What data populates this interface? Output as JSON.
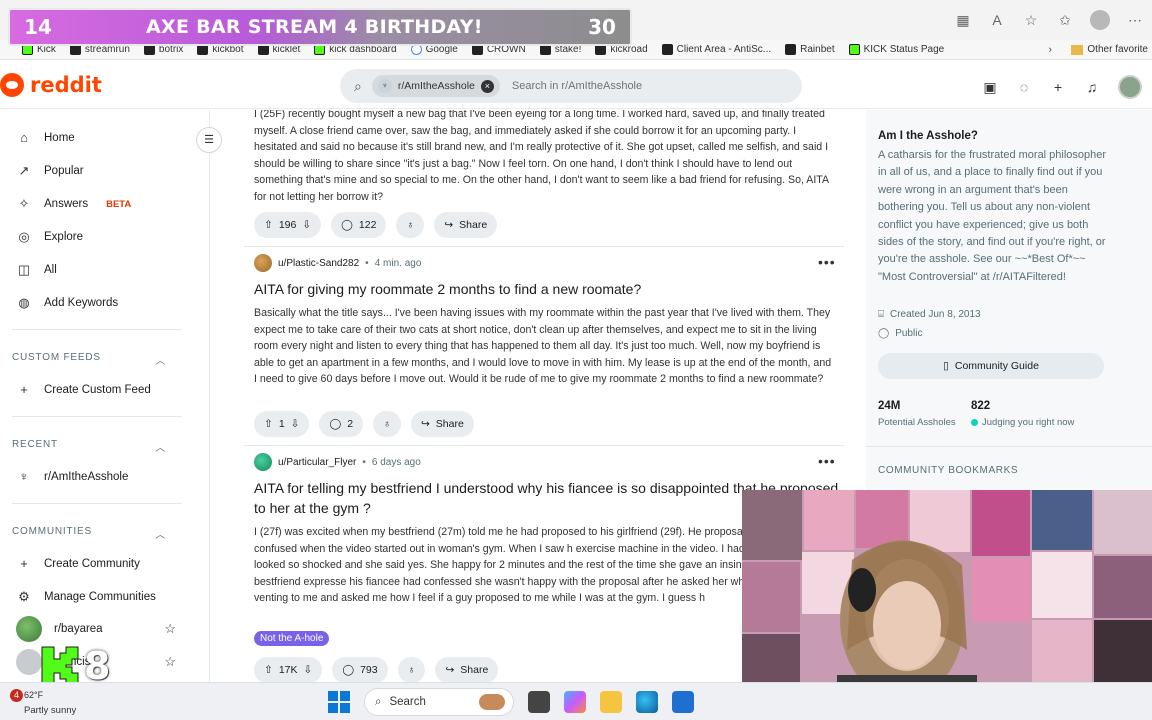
{
  "overlay": {
    "left_num": "14",
    "title": "AXE BAR STREAM 4 BIRTHDAY!",
    "right_num": "30"
  },
  "bookmarks": [
    {
      "label": "Kick",
      "icon": "kick-icon"
    },
    {
      "label": "streamrun",
      "icon": "streamrun-icon"
    },
    {
      "label": "botrix",
      "icon": "botrix-icon"
    },
    {
      "label": "kickbot",
      "icon": "kickbot-icon"
    },
    {
      "label": "kicklet",
      "icon": "kicklet-icon"
    },
    {
      "label": "kick dashboard",
      "icon": "kick-icon"
    },
    {
      "label": "Google",
      "icon": "google-icon"
    },
    {
      "label": "CROWN",
      "icon": "crown-icon"
    },
    {
      "label": "stake!",
      "icon": "stake-icon"
    },
    {
      "label": "kickroad",
      "icon": "kickroad-icon"
    },
    {
      "label": "Client Area - AntiSc...",
      "icon": "page-icon"
    },
    {
      "label": "Rainbet",
      "icon": "rainbet-icon"
    },
    {
      "label": "KICK Status Page",
      "icon": "kick-icon"
    }
  ],
  "bookmarks_other": "Other favorite",
  "header": {
    "logo_text": "reddit",
    "search_chip": "r/AmItheAsshole",
    "search_placeholder": "Search in r/AmItheAsshole"
  },
  "sidebar": {
    "nav": [
      {
        "label": "Home",
        "icon": "home-icon"
      },
      {
        "label": "Popular",
        "icon": "popular-icon"
      },
      {
        "label": "Answers",
        "icon": "answers-icon",
        "badge": "BETA"
      },
      {
        "label": "Explore",
        "icon": "explore-icon"
      },
      {
        "label": "All",
        "icon": "all-icon"
      },
      {
        "label": "Add Keywords",
        "icon": "keywords-icon"
      }
    ],
    "custom_feeds_title": "CUSTOM FEEDS",
    "create_custom_feed": "Create Custom Feed",
    "recent_title": "RECENT",
    "recent_item": "r/AmItheAsshole",
    "communities_title": "COMMUNITIES",
    "create_community": "Create Community",
    "manage_communities": "Manage Communities",
    "community_1": "r/bayarea",
    "community_2": "...ancis"
  },
  "posts": [
    {
      "body": "I (25F) recently bought myself a new bag that I've been eyeing for a long time. I worked hard, saved up, and finally treated myself. A close friend came over, saw the bag, and immediately asked if she could borrow it for an upcoming party. I hesitated and said no because it's still brand new, and I'm really protective of it. She got upset, called me selfish, and said I should be willing to share since \"it's just a bag.\" Now I feel torn. On one hand, I don't think I should have to lend out something that's mine and so special to me. On the other hand, I don't want to seem like a bad friend for refusing. So, AITA for not letting her borrow it?",
      "votes": "196",
      "comments": "122",
      "share": "Share"
    },
    {
      "author": "u/Plastic-Sand282",
      "time": "4 min. ago",
      "title": "AITA for giving my roommate 2 months to find a new roomate?",
      "body": "Basically what the title says... I've been having issues with my roommate within the past year that I've lived with them. They expect me to take care of their two cats at short notice, don't clean up after themselves, and expect me to sit in the living room every night and listen to every thing that has happened to them all day. It's just too much. Well, now my boyfriend is able to get an apartment in a few months, and I would love to move in with him. My lease is up at the end of the month, and I need to give 60 days before I move out. Would it be rude of me to give my roommate 2 months to find a new roommate?",
      "votes": "1",
      "comments": "2",
      "share": "Share"
    },
    {
      "author": "u/Particular_Flyer",
      "time": "6 days ago",
      "title": "AITA for telling my bestfriend I understood why his fiancee is so disappointed that he proposed to her at the gym ?",
      "body": "I (27f) was excited when my bestfriend (27m) told me he had proposed to his girlfriend (29f). He proposal on video. I was so confused when the video started out in woman's gym. When I saw h exercise machine in the video. I had a bad feeling. She looked so shocked and she said yes. She happy for 2 minutes and the rest of the time she gave an insincere smile. My bestfriend expresse his fiancee had confessed she wasn't happy with the proposal after he asked her why she looked venting to me and asked me how I feel if a guy proposed to me while I was at the gym. I guess h",
      "flair": "Not the A-hole",
      "votes": "17K",
      "comments": "793",
      "share": "Share"
    }
  ],
  "about": {
    "title": "Am I the Asshole?",
    "description": "A catharsis for the frustrated moral philosopher in all of us, and a place to finally find out if you were wrong in an argument that's been bothering you. Tell us about any non-violent conflict you have experienced; give us both sides of the story, and find out if you're right, or you're the asshole. See our ~~*Best Of*~~ \"Most Controversial\" at /r/AITAFiltered!",
    "created": "Created Jun 8, 2013",
    "visibility": "Public",
    "guide_button": "Community Guide",
    "members": "24M",
    "members_label": "Potential Assholes",
    "online": "822",
    "online_label": "Judging you right now",
    "bookmarks_title": "COMMUNITY BOOKMARKS"
  },
  "k8_text": "8",
  "taskbar": {
    "notification_count": "4",
    "temperature": "62°F",
    "weather": "Partly sunny",
    "search_label": "Search"
  },
  "colors": {
    "reddit_orange": "#ff4500",
    "flair_purple": "#7a62e8",
    "online_green": "#0dd3bb",
    "kick_green": "#53fc18"
  }
}
